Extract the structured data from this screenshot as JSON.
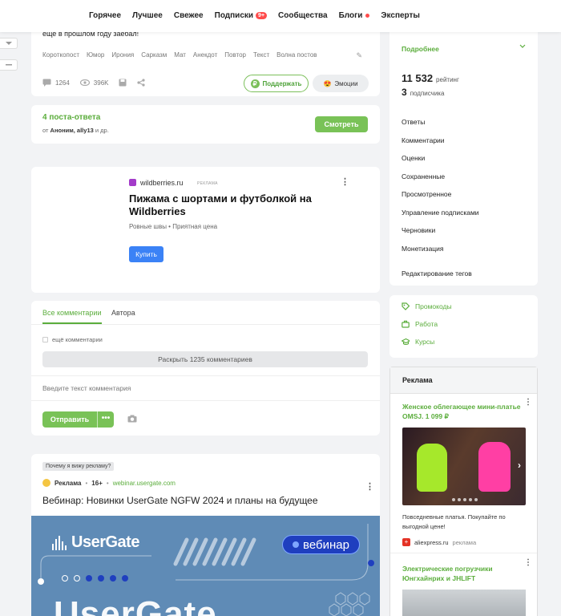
{
  "nav": [
    "Горячее",
    "Лучшее",
    "Свежее",
    "Подписки",
    "Сообщества",
    "Блоги",
    "Эксперты"
  ],
  "nav_badge": "9+",
  "post": {
    "text": "еще в прошлом году заебал!",
    "tags": [
      "Короткопост",
      "Юмор",
      "Ирония",
      "Сарказм",
      "Мат",
      "Анекдот",
      "Повтор",
      "Текст",
      "Волна постов"
    ],
    "comments_count": "1264",
    "views": "396K",
    "support_label": "Поддержать",
    "emotions_label": "Эмоции"
  },
  "answers": {
    "title": "4 поста-ответа",
    "from_prefix": "от",
    "from_names": "Аноним, ally13",
    "from_suffix": "и др.",
    "watch_label": "Смотреть"
  },
  "wb_ad": {
    "domain": "wildberries.ru",
    "ad_label": "РЕКЛАМА",
    "title": "Пижама с шортами и футболкой на Wildberries",
    "subtitle": "Ровные швы • Приятная цена",
    "buy_label": "Купить"
  },
  "comments": {
    "tab_all": "Все комментарии",
    "tab_author": "Автора",
    "more_label": "ещё комментарии",
    "expand_label": "Раскрыть 1235 комментариев",
    "input_placeholder": "Введите текст комментария",
    "send_label": "Отправить",
    "send_more": "•••"
  },
  "ug_ad": {
    "why_label": "Почему я вижу рекламу?",
    "ad_word": "Реклама",
    "age": "16+",
    "domain": "webinar.usergate.com",
    "title": "Вебинар: Новинки UserGate NGFW 2024 и планы на будущее",
    "brand": "UserGate",
    "pill": "вебинар",
    "big_text": "UserGate"
  },
  "sidebar": {
    "more_label": "Подробнее",
    "rating_value": "11 532",
    "rating_label": "рейтинг",
    "subs_value": "3",
    "subs_label": "подписчика",
    "menu": [
      "Ответы",
      "Комментарии",
      "Оценки",
      "Сохраненные",
      "Просмотренное",
      "Управление подписками",
      "Черновики",
      "Монетизация"
    ],
    "edit_tags": "Редактирование тегов",
    "links": [
      "Промокоды",
      "Работа",
      "Курсы"
    ]
  },
  "ads_block": {
    "title": "Реклама",
    "ad1_title": "Женское облегающее мини-платье OMSJ. 1 099 ₽",
    "ad1_desc": "Повседневные платья. Покупайте по выгодной цене!",
    "ad1_domain": "aliexpress.ru",
    "ad1_label": "реклама",
    "ad2_title": "Электрические погрузчики Юнгхайнрих и JHLIFT"
  },
  "colors": {
    "accent": "#5bad3c",
    "button_green": "#79c257",
    "blue": "#3b82f6"
  }
}
